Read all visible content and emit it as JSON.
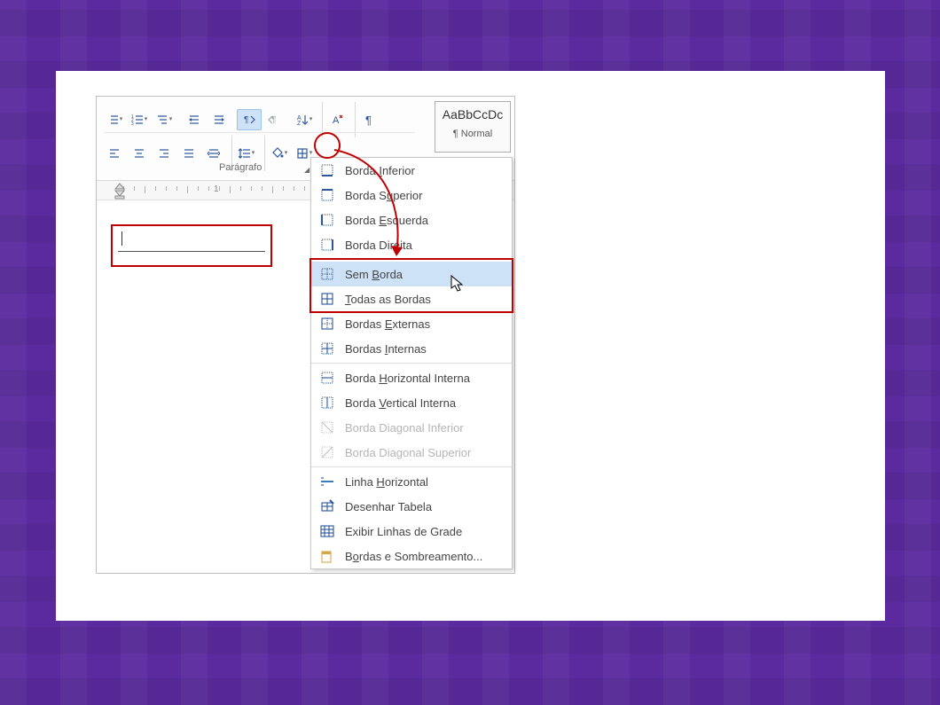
{
  "ribbon": {
    "group_label": "Parágrafo"
  },
  "ruler": {
    "marks": [
      "1"
    ]
  },
  "style": {
    "sample": "AaBbCcDc",
    "name": "¶ Normal"
  },
  "menu": {
    "items": [
      {
        "label": "Borda Inferior",
        "ul_index": 6,
        "icon": "border-bottom",
        "disabled": false,
        "highlight": false
      },
      {
        "label": "Borda Superior",
        "ul_index": 7,
        "icon": "border-top",
        "disabled": false,
        "highlight": false
      },
      {
        "label": "Borda Esquerda",
        "ul_index": 6,
        "icon": "border-left",
        "disabled": false,
        "highlight": false
      },
      {
        "label": "Borda Direita",
        "ul_index": 9,
        "icon": "border-right",
        "disabled": false,
        "highlight": false
      },
      {
        "sep": true
      },
      {
        "label": "Sem Borda",
        "ul_index": 4,
        "icon": "no-border",
        "disabled": false,
        "highlight": true
      },
      {
        "label": "Todas as Bordas",
        "ul_index": 0,
        "icon": "all-borders",
        "disabled": false,
        "highlight": false
      },
      {
        "label": "Bordas Externas",
        "ul_index": 7,
        "icon": "outside-borders",
        "disabled": false,
        "highlight": false
      },
      {
        "label": "Bordas Internas",
        "ul_index": 7,
        "icon": "inside-borders",
        "disabled": false,
        "highlight": false
      },
      {
        "sep": true
      },
      {
        "label": "Borda Horizontal Interna",
        "ul_index": 6,
        "icon": "inside-h-border",
        "disabled": false,
        "highlight": false
      },
      {
        "label": "Borda Vertical Interna",
        "ul_index": 6,
        "icon": "inside-v-border",
        "disabled": false,
        "highlight": false
      },
      {
        "label": "Borda Diagonal Inferior",
        "ul_index": -1,
        "icon": "diag-down-border",
        "disabled": true,
        "highlight": false
      },
      {
        "label": "Borda Diagonal Superior",
        "ul_index": -1,
        "icon": "diag-up-border",
        "disabled": true,
        "highlight": false
      },
      {
        "sep": true
      },
      {
        "label": "Linha Horizontal",
        "ul_index": 6,
        "icon": "h-line",
        "disabled": false,
        "highlight": false
      },
      {
        "label": "Desenhar Tabela",
        "ul_index": -1,
        "icon": "draw-table",
        "disabled": false,
        "highlight": false
      },
      {
        "label": "Exibir Linhas de Grade",
        "ul_index": -1,
        "icon": "view-gridlines",
        "disabled": false,
        "highlight": false
      },
      {
        "label": "Bordas e Sombreamento...",
        "ul_index": 1,
        "icon": "borders-shading",
        "disabled": false,
        "highlight": false
      }
    ]
  }
}
